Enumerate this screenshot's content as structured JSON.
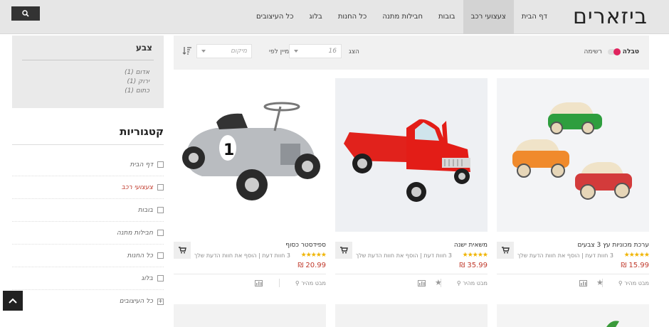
{
  "header": {
    "logo": "ביזארים",
    "nav": [
      {
        "label": "דף הבית",
        "active": false
      },
      {
        "label": "צעצועי רכב",
        "active": true
      },
      {
        "label": "בובות",
        "active": false
      },
      {
        "label": "חבילות מתנה",
        "active": false
      },
      {
        "label": "כל החנות",
        "active": false
      },
      {
        "label": "בלוג",
        "active": false
      },
      {
        "label": "כל העיצובים",
        "active": false
      }
    ],
    "search_icon": "search-icon"
  },
  "sidebar": {
    "color_filter": {
      "title": "צבע",
      "options": [
        "אדום (1)",
        "ירוק (1)",
        "כתום (1)"
      ]
    },
    "categories": {
      "title": "קטגוריות",
      "items": [
        {
          "label": "דף הבית",
          "highlight": false
        },
        {
          "label": "צעצועי רכב",
          "highlight": true
        },
        {
          "label": "בובות",
          "highlight": false
        },
        {
          "label": "חבילות מתנה",
          "highlight": false
        },
        {
          "label": "כל החנות",
          "highlight": false
        },
        {
          "label": "בלוג",
          "highlight": false
        },
        {
          "label": "כל העיצובים",
          "highlight": false
        }
      ]
    }
  },
  "toolbar": {
    "view_table": "טבלה",
    "view_list": "רשימה",
    "show_label": "הצג",
    "show_value": "16",
    "sort_label": "מיין לפי",
    "sort_value": "מיקום"
  },
  "products": [
    {
      "name": "ערכת מכוניות עץ 3 צבעים",
      "stars": "★★★★★",
      "reviews": "3 חוות דעת  |  הוסף את חוות הדעת שלך",
      "price": "15.99 ₪",
      "quick": "מבט מהיר"
    },
    {
      "name": "משאית ישנה",
      "stars": "★★★★★",
      "reviews": "3 חוות דעת  |  הוסף את חוות הדעת שלך",
      "price": "35.99 ₪",
      "quick": "מבט מהיר"
    },
    {
      "name": "ספידסטר כסוף",
      "stars": "★★★★★",
      "reviews": "3 חוות דעת  |  הוסף את חוות הדעת שלך",
      "price": "20.99 ₪",
      "quick": "מבט מהיר"
    }
  ],
  "colors": {
    "accent": "#e0245e",
    "price": "#c0392b",
    "star": "#f0b400",
    "header_bg": "#e6e6e6"
  }
}
